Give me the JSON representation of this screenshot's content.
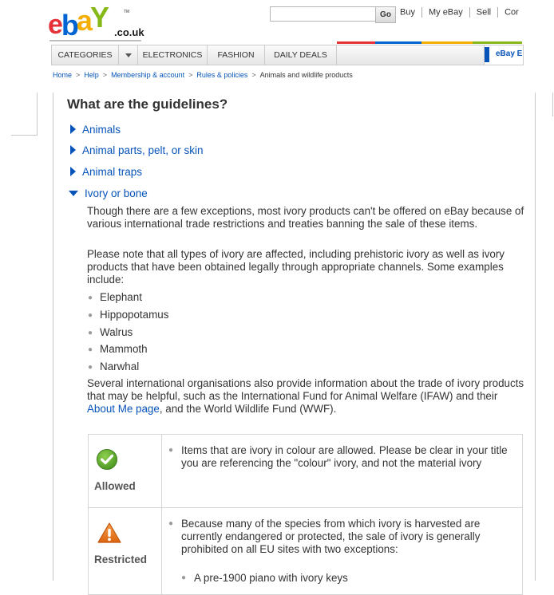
{
  "header": {
    "logo_suffix": ".co.uk",
    "logo_tm": "TM",
    "search_placeholder": "",
    "go_label": "Go",
    "top_links": [
      "Buy",
      "My eBay",
      "Sell",
      "Cor"
    ],
    "brand_colors": [
      "#e53238",
      "#0064d2",
      "#f5af02",
      "#86b817"
    ]
  },
  "nav": {
    "items": [
      "CATEGORIES",
      "ELECTRONICS",
      "FASHION",
      "DAILY DEALS"
    ],
    "ebay_tab": "eBay E"
  },
  "breadcrumb": [
    "Home",
    "Help",
    "Membership & account",
    "Rules & policies",
    "Animals and wildlife products"
  ],
  "content": {
    "heading": "What are the guidelines?",
    "sections": [
      "Animals",
      "Animal parts, pelt, or skin",
      "Animal traps",
      "Ivory or bone"
    ],
    "para1": "Though there are a few exceptions, most ivory products can't be offered on eBay because of various international trade restrictions and treaties banning the sale of these items.",
    "para2": "Please note that all types of ivory are affected, including prehistoric ivory as well as ivory products that have been obtained legally through appropriate channels. Some examples include:",
    "examples": [
      "Elephant",
      "Hippopotamus",
      "Walrus",
      "Mammoth",
      "Narwhal"
    ],
    "para3_before": "Several international organisations also provide information about the trade of ivory products that may be helpful, such as the International Fund for Animal Welfare (IFAW) and their ",
    "para3_link": "About Me page",
    "para3_after": ", and the World Wildlife Fund (WWF)."
  },
  "table": {
    "allowed_label": "Allowed",
    "allowed_text": "Items that are ivory in colour are allowed. Please be clear in your title you are referencing the \"colour\" ivory, and not the material ivory",
    "restricted_label": "Restricted",
    "restricted_text": "Because many of the species from which ivory is harvested are currently endangered or protected, the sale of ivory is generally prohibited on all EU sites with two exceptions:",
    "restricted_sub": "A pre-1900 piano with ivory keys",
    "allowed_color": "#5aa12a",
    "restricted_color": "#e87a1e"
  }
}
